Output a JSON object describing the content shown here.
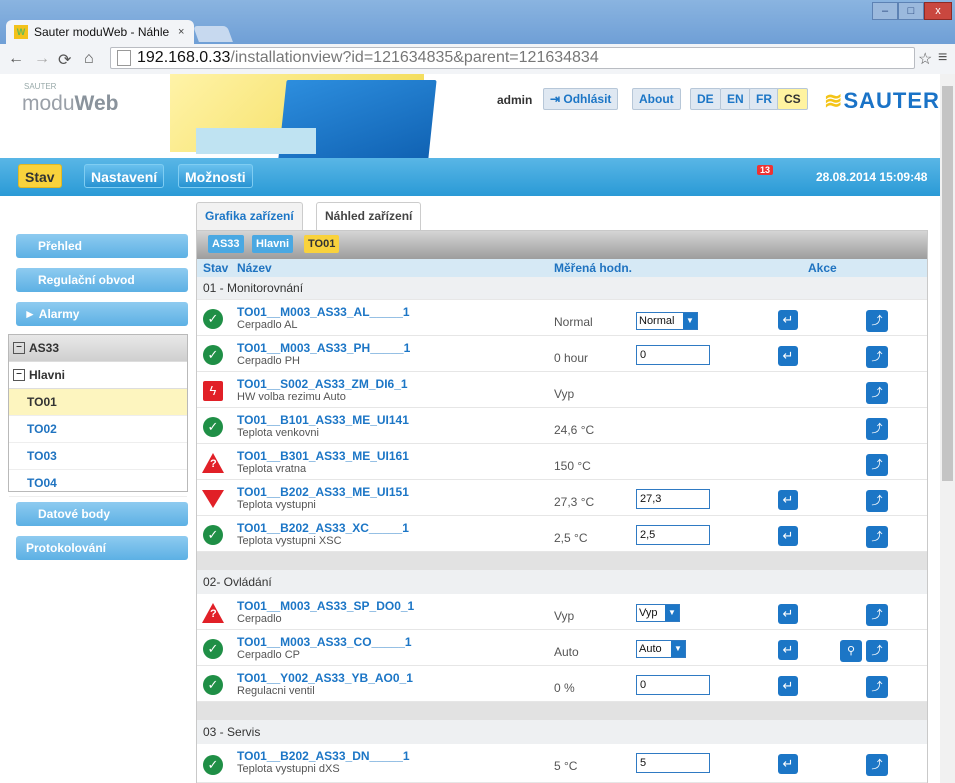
{
  "browser": {
    "tab_title": "Sauter moduWeb - Náhle",
    "tab_close": "×",
    "favicon": "W",
    "url_host": "192.168.0.33",
    "url_path": "/installationview?id=121634835&parent=121634834",
    "win_min": "–",
    "win_max": "□",
    "win_close": "x"
  },
  "header": {
    "brand_small": "SAUTER",
    "brand_prefix": "modu",
    "brand_suffix": "Web",
    "user": "admin",
    "logout": "Odhlásit",
    "about": "About",
    "languages": [
      "DE",
      "EN",
      "FR",
      "CS"
    ],
    "selected_language": "CS",
    "sauter_logo": "SAUTER"
  },
  "navbar": {
    "items": [
      "Stav",
      "Nastavení",
      "Možnosti"
    ],
    "active": "Stav",
    "alarm_count": "13",
    "datetime": "28.08.2014 15:09:48"
  },
  "sidebar": {
    "top_buttons": [
      "Přehled",
      "Regulační obvod",
      "Alarmy"
    ],
    "alarmy_prefix": "►",
    "tree_root": "AS33",
    "tree_group": "Hlavni",
    "tree_items": [
      "TO01",
      "TO02",
      "TO03",
      "TO04"
    ],
    "selected_item": "TO01",
    "bottom_buttons": [
      "Datové body",
      "Protokolování"
    ]
  },
  "content": {
    "tabs": [
      "Grafika zařízení",
      "Náhled zařízení"
    ],
    "active_tab": "Náhled zařízení",
    "breadcrumb": [
      "AS33",
      "Hlavni",
      "TO01"
    ],
    "columns": {
      "state": "Stav",
      "name": "Název",
      "value": "Měřená hodn.",
      "action": "Akce"
    },
    "groups": [
      {
        "title": "01 - Monitorovnání",
        "rows": [
          {
            "name": "TO01__M003_AS33_AL_____1",
            "desc": "Cerpadlo AL",
            "value": "Normal",
            "input": "Normal"
          },
          {
            "name": "TO01__M003_AS33_PH_____1",
            "desc": "Cerpadlo PH",
            "value": "0 hour",
            "input": "0"
          },
          {
            "name": "TO01__S002_AS33_ZM_DI6_1",
            "desc": "HW volba rezimu Auto",
            "value": "Vyp",
            "input": ""
          },
          {
            "name": "TO01__B101_AS33_ME_UI141",
            "desc": "Teplota venkovni",
            "value": "24,6 °C",
            "input": ""
          },
          {
            "name": "TO01__B301_AS33_ME_UI161",
            "desc": "Teplota vratna",
            "value": "150 °C",
            "input": ""
          },
          {
            "name": "TO01__B202_AS33_ME_UI151",
            "desc": "Teplota vystupni",
            "value": "27,3 °C",
            "input": "27,3"
          },
          {
            "name": "TO01__B202_AS33_XC_____1",
            "desc": "Teplota vystupni XSC",
            "value": "2,5 °C",
            "input": "2,5"
          }
        ]
      },
      {
        "title": "02- Ovládání",
        "rows": [
          {
            "name": "TO01__M003_AS33_SP_DO0_1",
            "desc": "Cerpadlo",
            "value": "Vyp",
            "input": "Vyp"
          },
          {
            "name": "TO01__M003_AS33_CO_____1",
            "desc": "Cerpadlo CP",
            "value": "Auto",
            "input": "Auto"
          },
          {
            "name": "TO01__Y002_AS33_YB_AO0_1",
            "desc": "Regulacni ventil",
            "value": "0 %",
            "input": "0"
          }
        ]
      },
      {
        "title": "03 - Servis",
        "rows": [
          {
            "name": "TO01__B202_AS33_DN_____1",
            "desc": "Teplota vystupni dXS",
            "value": "5 °C",
            "input": "5"
          }
        ]
      }
    ]
  },
  "colors": {
    "accent": "#1c76c6",
    "nav_blue": "#2a9ad6",
    "selected_yellow": "#f9d23c",
    "ok_green": "#1f8f46",
    "alarm_red": "#e12027"
  }
}
